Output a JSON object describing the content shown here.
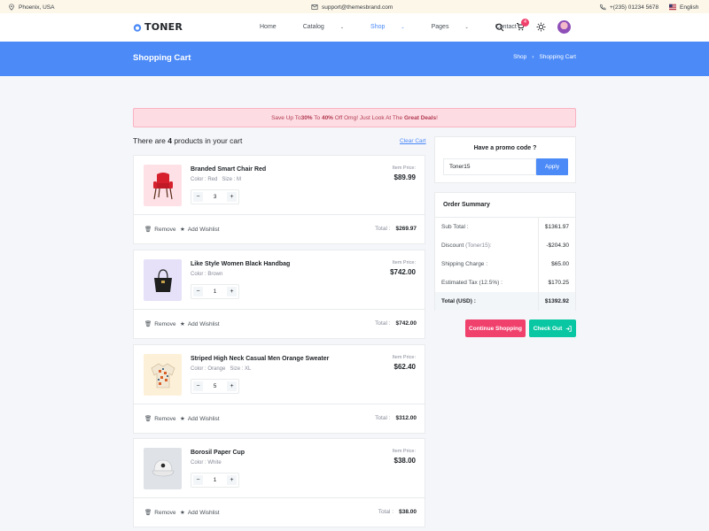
{
  "topbar": {
    "location": "Phoenix, USA",
    "email": "support@themesbrand.com",
    "phone": "+(235) 01234 5678",
    "language": "English"
  },
  "header": {
    "logo": "TONER",
    "nav": [
      "Home",
      "Catalog",
      "Shop",
      "Pages",
      "Contact"
    ],
    "active_nav": "Shop",
    "cart_count": "4"
  },
  "banner": {
    "title": "Shopping Cart",
    "breadcrumb": [
      "Shop",
      "Shopping Cart"
    ]
  },
  "alert": {
    "prefix": "Save Up To ",
    "p1": "30%",
    "mid": " To ",
    "p2": "40%",
    "mid2": " Off Omg! Just Look At The ",
    "deal": "Great Deals",
    "suffix": "!"
  },
  "cart": {
    "head_prefix": "There are ",
    "count": "4",
    "head_suffix": " products in your cart",
    "clear_label": "Clear Cart",
    "item_price_label": "Item Price:",
    "remove_label": "Remove",
    "wishlist_label": "Add Wishlist",
    "total_label": "Total :",
    "items": [
      {
        "name": "Branded Smart Chair Red",
        "meta": "Color : Red   Size : M",
        "qty": "3",
        "price": "$89.99",
        "total": "$269.97"
      },
      {
        "name": "Like Style Women Black Handbag",
        "meta": "Color : Brown",
        "qty": "1",
        "price": "$742.00",
        "total": "$742.00"
      },
      {
        "name": "Striped High Neck Casual Men Orange Sweater",
        "meta": "Color : Orange   Size : XL",
        "qty": "5",
        "price": "$62.40",
        "total": "$312.00"
      },
      {
        "name": "Borosil Paper Cup",
        "meta": "Color : White",
        "qty": "1",
        "price": "$38.00",
        "total": "$38.00"
      }
    ]
  },
  "promo": {
    "title": "Have a promo code ?",
    "value": "Toner15",
    "apply_label": "Apply"
  },
  "summary": {
    "title": "Order Summary",
    "subtotal_label": "Sub Total :",
    "subtotal": "$1361.97",
    "discount_label": "Discount",
    "discount_code": "(Toner15):",
    "discount": "-$204.30",
    "shipping_label": "Shipping Charge :",
    "shipping": "$65.00",
    "tax_label": "Estimated Tax",
    "tax_rate": "(12.5%) :",
    "tax": "$170.25",
    "total_label": "Total (USD) :",
    "total": "$1392.92"
  },
  "actions": {
    "continue_label": "Continue Shopping",
    "checkout_label": "Check Out"
  },
  "colors": {
    "primary": "#4b8af7",
    "danger": "#f0406c",
    "success": "#0ac7a3"
  }
}
